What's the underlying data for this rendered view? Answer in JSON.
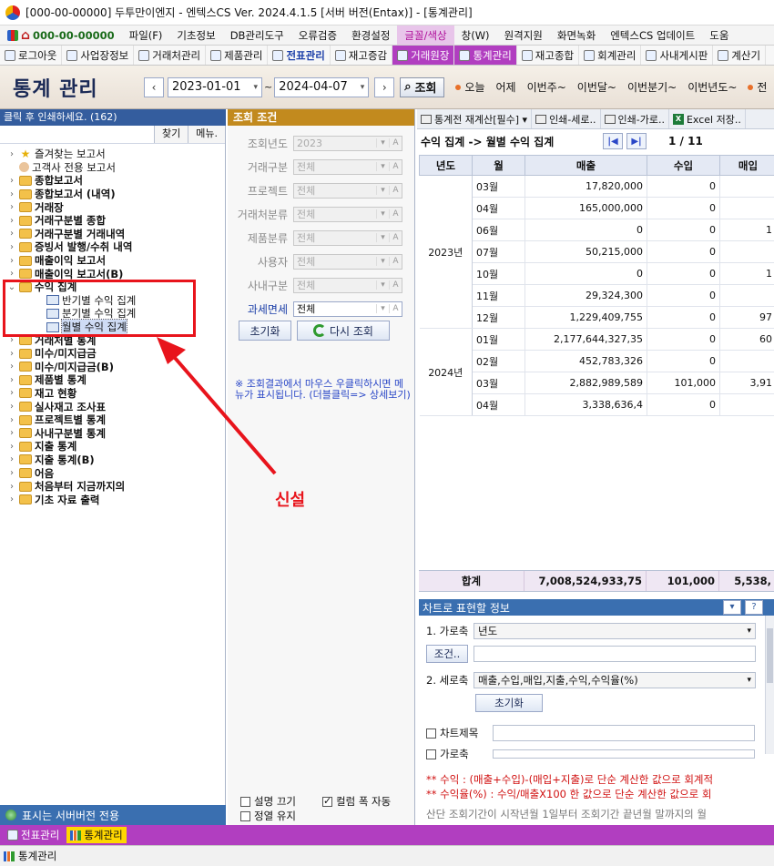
{
  "titlebar": {
    "text": "[000-00-00000] 두투만이엔지 - 엔텍스CS Ver. 2024.4.1.5 [서버 버전(Entax)] - [통계관리]"
  },
  "menu": {
    "items": [
      {
        "label": "000-00-00000",
        "kind": "company"
      },
      {
        "label": "파일(F)"
      },
      {
        "label": "기초정보"
      },
      {
        "label": "DB관리도구"
      },
      {
        "label": "오류검증"
      },
      {
        "label": "환경설정"
      },
      {
        "label": "글꼴/색상",
        "kind": "hl"
      },
      {
        "label": "창(W)"
      },
      {
        "label": "원격지원"
      },
      {
        "label": "화면녹화"
      },
      {
        "label": "엔텍스CS 업데이트"
      },
      {
        "label": "도움"
      }
    ]
  },
  "toolbar": {
    "items": [
      {
        "label": "로그아웃"
      },
      {
        "label": "사업장정보"
      },
      {
        "label": "거래처관리"
      },
      {
        "label": "제품관리"
      },
      {
        "label": "전표관리",
        "kind": "active"
      },
      {
        "label": "재고증감"
      },
      {
        "label": "거래원장",
        "kind": "hl"
      },
      {
        "label": "통계관리",
        "kind": "hl"
      },
      {
        "label": "재고종합"
      },
      {
        "label": "회계관리"
      },
      {
        "label": "사내게시판"
      },
      {
        "label": "계산기"
      }
    ]
  },
  "header": {
    "title": "통계 관리",
    "date_from": "2023-01-01",
    "date_to": "2024-04-07",
    "tilde": "~",
    "search_label": "조회",
    "quick": [
      "오늘",
      "어제",
      "이번주~",
      "이번달~",
      "이번분기~",
      "이번년도~",
      "전"
    ]
  },
  "left": {
    "header": "클릭 후 인쇄하세요. (162)",
    "find_label": "찾기",
    "menu_label": "메뉴.",
    "footer": "표시는 서버버전 전용",
    "tree": [
      {
        "label": "즐겨찾는 보고서",
        "icon": "star",
        "exp": "+",
        "bold": false
      },
      {
        "label": "고객사 전용 보고서",
        "icon": "person",
        "exp": "",
        "bold": false
      },
      {
        "label": "종합보고서",
        "icon": "folder",
        "exp": "+",
        "bold": true
      },
      {
        "label": "종합보고서 (내역)",
        "icon": "folder",
        "exp": "+",
        "bold": true
      },
      {
        "label": "거래장",
        "icon": "folder",
        "exp": "+",
        "bold": true
      },
      {
        "label": "거래구분별 종합",
        "icon": "folder",
        "exp": "+",
        "bold": true
      },
      {
        "label": "거래구분별 거래내역",
        "icon": "folder",
        "exp": "+",
        "bold": true
      },
      {
        "label": "증빙서 발행/수취 내역",
        "icon": "folder",
        "exp": "+",
        "bold": true
      },
      {
        "label": "매출이익 보고서",
        "icon": "folder",
        "exp": "+",
        "bold": true
      },
      {
        "label": "매출이익 보고서(B)",
        "icon": "folder",
        "exp": "+",
        "bold": true
      },
      {
        "label": "수익 집계",
        "icon": "folder",
        "exp": "-",
        "bold": true
      },
      {
        "label": "반기별 수익 집계",
        "icon": "report",
        "exp": "",
        "bold": false,
        "indent": 1
      },
      {
        "label": "분기별 수익 집계",
        "icon": "report",
        "exp": "",
        "bold": false,
        "indent": 1
      },
      {
        "label": "월별 수익 집계",
        "icon": "report",
        "exp": "",
        "bold": false,
        "indent": 1,
        "selected": true
      },
      {
        "label": "거래처별 통계",
        "icon": "folder",
        "exp": "+",
        "bold": true
      },
      {
        "label": "미수/미지급금",
        "icon": "folder",
        "exp": "+",
        "bold": true
      },
      {
        "label": "미수/미지급금(B)",
        "icon": "folder",
        "exp": "+",
        "bold": true
      },
      {
        "label": "제품별 통계",
        "icon": "folder",
        "exp": "+",
        "bold": true
      },
      {
        "label": "재고 현황",
        "icon": "folder",
        "exp": "+",
        "bold": true
      },
      {
        "label": "실사재고 조사표",
        "icon": "folder",
        "exp": "+",
        "bold": true
      },
      {
        "label": "프로젝트별 통계",
        "icon": "folder",
        "exp": "+",
        "bold": true
      },
      {
        "label": "사내구분별 통계",
        "icon": "folder",
        "exp": "+",
        "bold": true
      },
      {
        "label": "지출 통계",
        "icon": "folder",
        "exp": "+",
        "bold": true
      },
      {
        "label": "지출 통계(B)",
        "icon": "folder",
        "exp": "+",
        "bold": true
      },
      {
        "label": "어음",
        "icon": "folder",
        "exp": "+",
        "bold": true
      },
      {
        "label": "처음부터 지금까지의",
        "icon": "folder",
        "exp": "+",
        "bold": true
      },
      {
        "label": "기초 자료 출력",
        "icon": "folder",
        "exp": "+",
        "bold": true
      }
    ]
  },
  "conditions": {
    "header": "조회 조건",
    "rows": [
      {
        "label": "조회년도",
        "value": "2023",
        "active": false
      },
      {
        "label": "거래구분",
        "value": "전체",
        "active": false
      },
      {
        "label": "프로젝트",
        "value": "전체",
        "active": false
      },
      {
        "label": "거래처분류",
        "value": "전체",
        "active": false
      },
      {
        "label": "제품분류",
        "value": "전체",
        "active": false
      },
      {
        "label": "사용자",
        "value": "전체",
        "active": false
      },
      {
        "label": "사내구분",
        "value": "전체",
        "active": false
      },
      {
        "label": "과세면세",
        "value": "전체",
        "active": true
      }
    ],
    "reset_label": "초기화",
    "research_label": "다시 조회",
    "note": "※ 조회결과에서 마우스 우클릭하시면 메뉴가 표시됩니다. (더블클릭=> 상세보기)",
    "check_desc": "설명 끄기",
    "check_autowidth": "컬럼 폭 자동",
    "check_sort": "정열 유지"
  },
  "result": {
    "toolbar": [
      "통계전 재계산[필수] ▾",
      "인쇄-세로..",
      "인쇄-가로..",
      "Excel 저장.."
    ],
    "breadcrumb": "수익 집계 -> 월별 수익 집계",
    "page": "1 / 11",
    "columns": [
      "년도",
      "월",
      "매출",
      "수입",
      "매입"
    ],
    "groups": [
      {
        "year": "2023년",
        "rows": [
          {
            "month": "03월",
            "sales": "17,820,000",
            "income": "0",
            "purchase": ""
          },
          {
            "month": "04월",
            "sales": "165,000,000",
            "income": "0",
            "purchase": ""
          },
          {
            "month": "06월",
            "sales": "0",
            "income": "0",
            "purchase": "1"
          },
          {
            "month": "07월",
            "sales": "50,215,000",
            "income": "0",
            "purchase": ""
          },
          {
            "month": "10월",
            "sales": "0",
            "income": "0",
            "purchase": "1"
          },
          {
            "month": "11월",
            "sales": "29,324,300",
            "income": "0",
            "purchase": ""
          },
          {
            "month": "12월",
            "sales": "1,229,409,755",
            "income": "0",
            "purchase": "97"
          }
        ]
      },
      {
        "year": "2024년",
        "rows": [
          {
            "month": "01월",
            "sales": "2,177,644,327,35",
            "income": "0",
            "purchase": "60"
          },
          {
            "month": "02월",
            "sales": "452,783,326",
            "income": "0",
            "purchase": ""
          },
          {
            "month": "03월",
            "sales": "2,882,989,589",
            "income": "101,000",
            "purchase": "3,91"
          },
          {
            "month": "04월",
            "sales": "3,338,636,4",
            "income": "0",
            "purchase": ""
          }
        ]
      }
    ],
    "total": {
      "label": "합계",
      "sales": "7,008,524,933,75",
      "income": "101,000",
      "purchase": "5,538,"
    }
  },
  "chart_info": {
    "header": "차트로 표현할 정보",
    "x_axis_label": "1. 가로축",
    "x_axis_value": "년도",
    "condition_label": "조건..",
    "y_axis_label": "2. 세로축",
    "y_axis_value": "매출,수입,매입,지출,수익,수익율(%)",
    "reset_label": "초기화",
    "chart_title_label": "차트제목",
    "x_axis_check": "가로축"
  },
  "notes": [
    "** 수익 : (매출+수입)-(매입+지출)로 단순 계산한 값으로 회계적",
    "** 수익율(%) : 수익/매출X100 한 값으로 단순 계산한 값으로 회",
    "산단 조회기간이 시작년월 1일부터 조회기간 끝년월 말까지의 월"
  ],
  "bottom_tabs": [
    "전표관리",
    "통계관리"
  ],
  "status": "통계관리",
  "annotation": {
    "label": "신설"
  }
}
